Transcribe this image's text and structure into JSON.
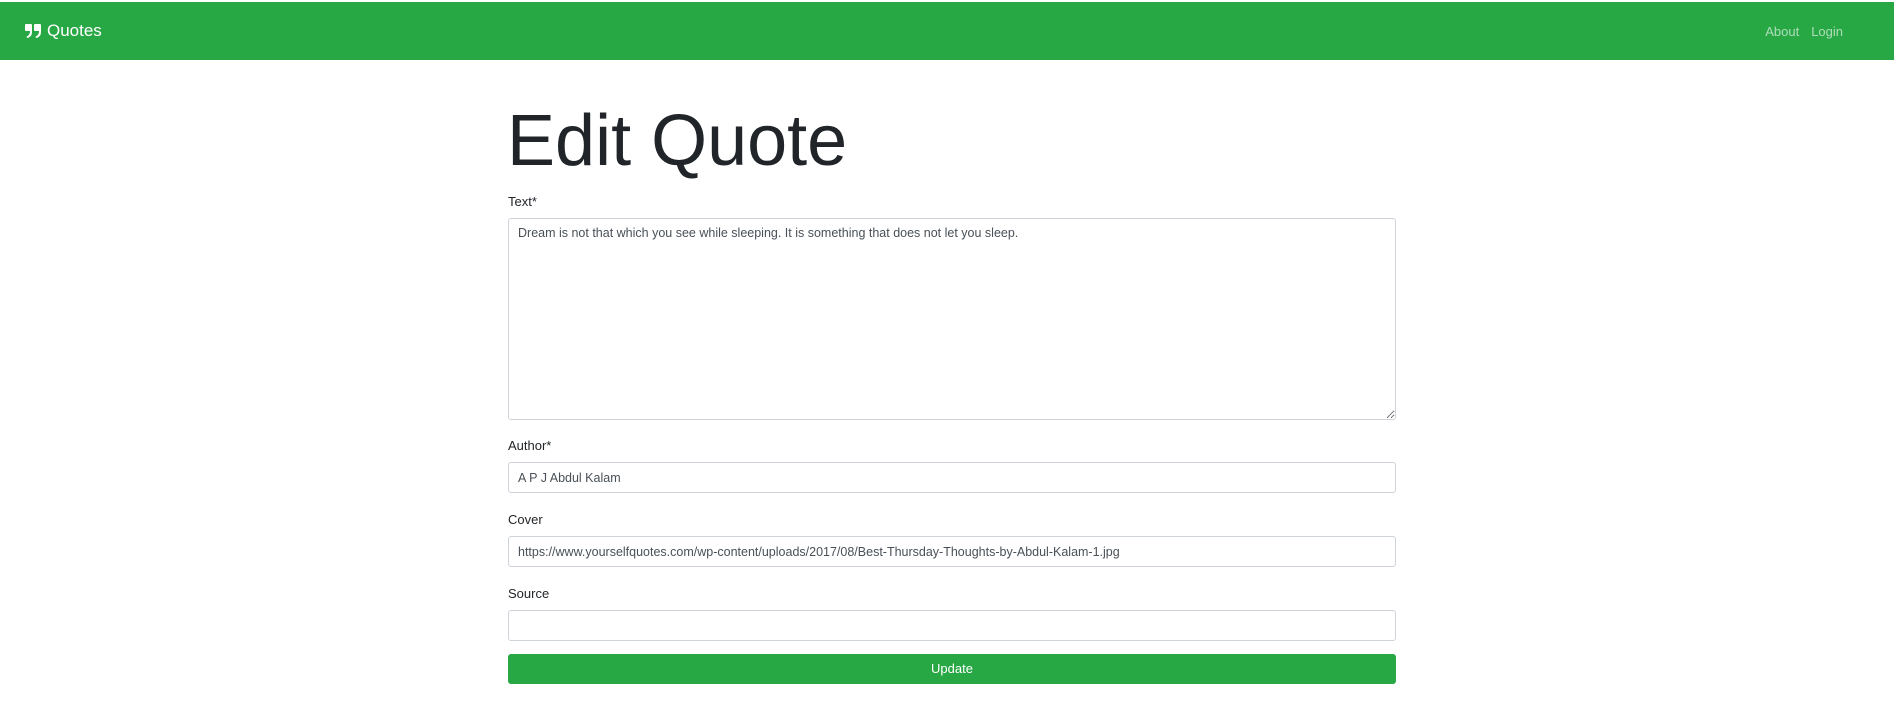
{
  "navbar": {
    "brand_label": "Quotes",
    "brand_icon": "quote-right-icon",
    "links": [
      {
        "label": "About"
      },
      {
        "label": "Login"
      }
    ],
    "color": "#28a745"
  },
  "page": {
    "title": "Edit Quote"
  },
  "form": {
    "text": {
      "label": "Text*",
      "value": "Dream is not that which you see while sleeping. It is something that does not let you sleep."
    },
    "author": {
      "label": "Author*",
      "value": "A P J Abdul Kalam"
    },
    "cover": {
      "label": "Cover",
      "value": "https://www.yourselfquotes.com/wp-content/uploads/2017/08/Best-Thursday-Thoughts-by-Abdul-Kalam-1.jpg"
    },
    "source": {
      "label": "Source",
      "value": ""
    },
    "submit_label": "Update"
  }
}
